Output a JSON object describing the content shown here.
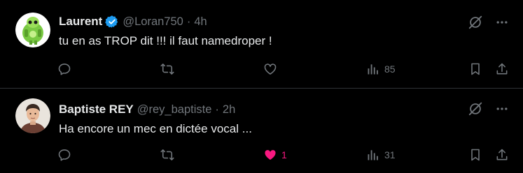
{
  "colors": {
    "background": "#000000",
    "text_primary": "#e7e9ea",
    "text_secondary": "#71767b",
    "divider": "#2f3336",
    "verified_blue": "#1d9bf0",
    "like_pink": "#f91880"
  },
  "tweets": [
    {
      "display_name": "Laurent",
      "verified": true,
      "handle": "@Loran750",
      "separator": "·",
      "time": "4h",
      "text": "tu en as TROP dit !!! il faut namedroper !",
      "avatar_icon": "green-robot-avatar",
      "actions": {
        "reply_count": "",
        "retweet_count": "",
        "like_count": "",
        "liked": false,
        "views_count": "85"
      }
    },
    {
      "display_name": "Baptiste REY",
      "verified": false,
      "handle": "@rey_baptiste",
      "separator": "·",
      "time": "2h",
      "text": "Ha encore un mec en dictée vocal ...",
      "avatar_icon": "person-photo-avatar",
      "actions": {
        "reply_count": "",
        "retweet_count": "",
        "like_count": "1",
        "liked": true,
        "views_count": "31"
      }
    }
  ]
}
